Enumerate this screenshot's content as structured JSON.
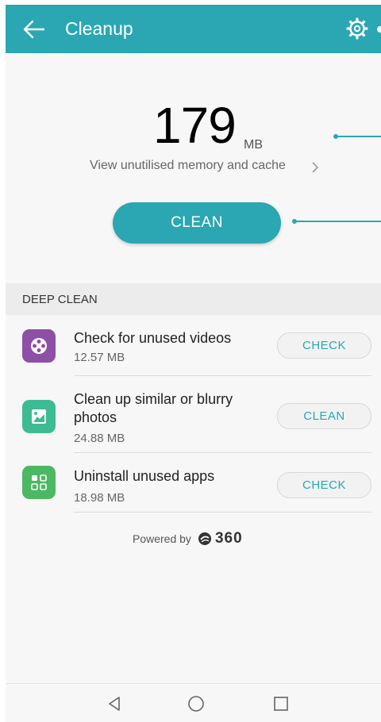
{
  "app": {
    "title": "Cleanup"
  },
  "summary": {
    "amount": "179",
    "unit": "MB",
    "link_text": "View unutilised memory and cache"
  },
  "primary_action": {
    "label": "CLEAN"
  },
  "deep_clean": {
    "section_title": "DEEP CLEAN",
    "items": [
      {
        "title": "Check for unused videos",
        "size": "12.57 MB",
        "action": "CHECK",
        "icon": "video-reel-icon",
        "icon_color": "#8e4fa7"
      },
      {
        "title": "Clean up similar or blurry photos",
        "size": "24.88 MB",
        "action": "CLEAN",
        "icon": "photo-icon",
        "icon_color": "#3dbb93"
      },
      {
        "title": "Uninstall unused apps",
        "size": "18.98 MB",
        "action": "CHECK",
        "icon": "apps-grid-icon",
        "icon_color": "#4cb863"
      }
    ]
  },
  "footer": {
    "powered_by": "Powered by",
    "brand": "360"
  },
  "colors": {
    "accent": "#2aa7b2",
    "header": "#2aa7b2"
  }
}
